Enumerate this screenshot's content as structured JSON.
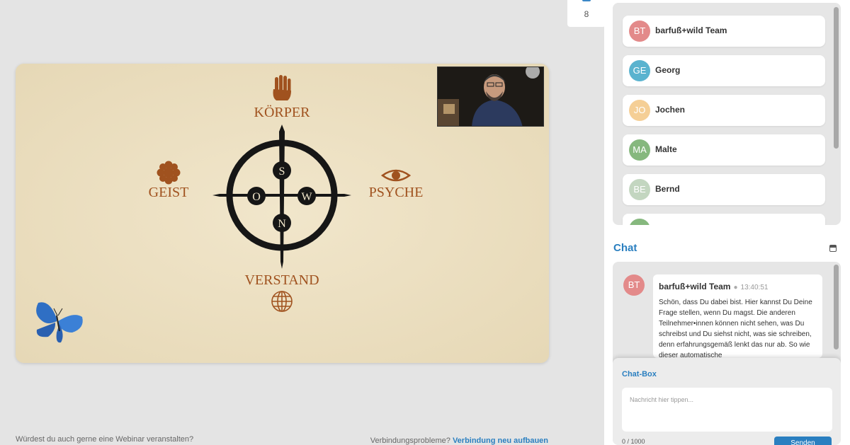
{
  "participant_count": "8",
  "participants": [
    {
      "initials": "BT",
      "name": "barfuß+wild Team",
      "color": "#e38a8a"
    },
    {
      "initials": "GE",
      "name": "Georg",
      "color": "#5ab3cf"
    },
    {
      "initials": "JO",
      "name": "Jochen",
      "color": "#f5cf96"
    },
    {
      "initials": "MA",
      "name": "Malte",
      "color": "#86b87e"
    },
    {
      "initials": "BE",
      "name": "Bernd",
      "color": "#c3d6c0"
    }
  ],
  "chat": {
    "title": "Chat",
    "message": {
      "initials": "BT",
      "author": "barfuß+wild Team",
      "dot": "●",
      "time": "13:40:51",
      "text": "Schön, dass Du dabei bist. Hier kannst Du Deine Frage stellen, wenn Du magst. Die anderen Teilnehmer•innen können nicht sehen, was Du schreibst und Du siehst nicht, was sie schreiben, denn erfahrungsgemäß lenkt das nur ab. So wie dieser automatische"
    },
    "box_label": "Chat-Box",
    "placeholder": "Nachricht hier tippen...",
    "counter": "0 / 1000",
    "send_label": "Senden"
  },
  "slide": {
    "top_label": "KÖRPER",
    "left_label": "GEIST",
    "right_label": "PSYCHE",
    "bottom_label": "VERSTAND",
    "compass": {
      "north": "S",
      "west": "O",
      "east": "W",
      "south": "N"
    },
    "accent_color": "#a0521f"
  },
  "footer": {
    "left": "Würdest du auch gerne eine Webinar veranstalten?",
    "right_prefix": "Verbindungsprobleme? ",
    "right_link": "Verbindung neu aufbauen"
  }
}
